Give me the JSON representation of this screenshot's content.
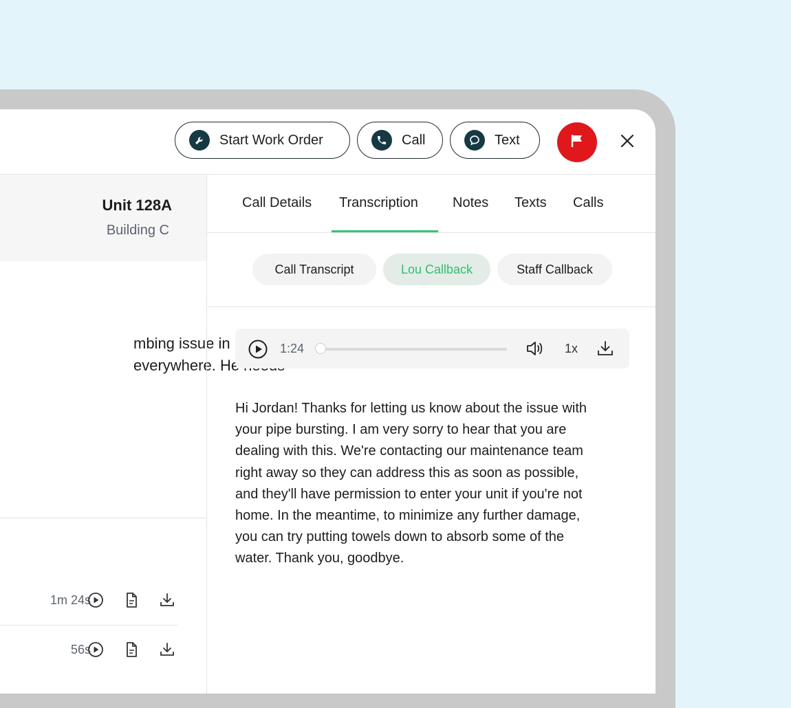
{
  "header": {
    "start_work_order_label": "Start Work Order",
    "call_label": "Call",
    "text_label": "Text"
  },
  "left_panel": {
    "unit_title": "Unit 128A",
    "unit_building": "Building C",
    "summary_lines": [
      "mbing issue in his",
      "everywhere. He needs"
    ],
    "recordings": [
      {
        "duration": "1m 24s"
      },
      {
        "duration": "56s"
      }
    ]
  },
  "tabs": [
    "Call Details",
    "Transcription",
    "Notes",
    "Texts",
    "Calls"
  ],
  "active_tab": "Transcription",
  "subtabs": [
    "Call Transcript",
    "Lou Callback",
    "Staff Callback"
  ],
  "active_subtab": "Lou Callback",
  "player": {
    "time": "1:24",
    "speed": "1x",
    "progress": 0
  },
  "transcript_lines": [
    "Hi Jordan! Thanks for letting us know about the issue with",
    "your pipe bursting. I am very sorry to hear that you are",
    "dealing with this. We're contacting our maintenance team",
    "right away so they can address this as soon as possible,",
    "and they'll have permission to enter your unit if you're not",
    "home. In the meantime, to minimize any further damage,",
    "you can try putting towels down to absorb some of the",
    "water. Thank you, goodbye."
  ],
  "colors": {
    "accent_green": "#2fc777",
    "flag_red": "#e0181b",
    "icon_dark": "#163a44",
    "background": "#e3f5fa"
  }
}
